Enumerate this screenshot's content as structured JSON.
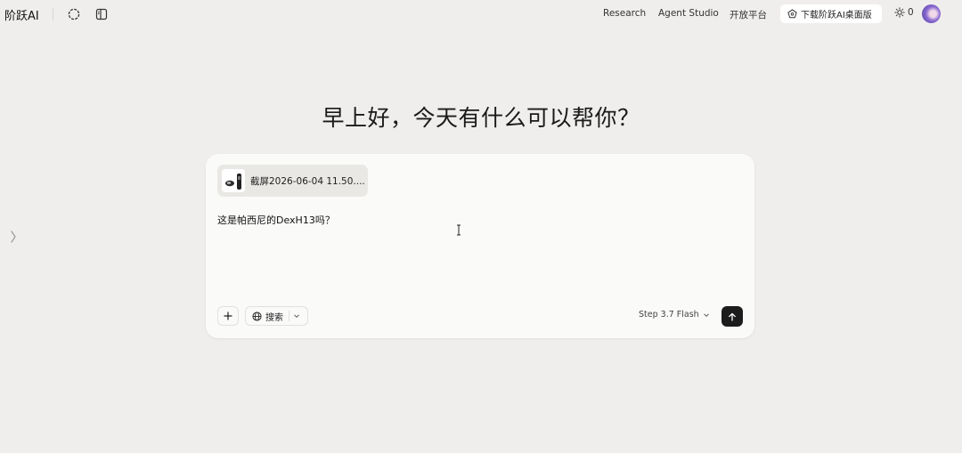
{
  "header": {
    "brand": "阶跃AI",
    "nav": [
      "Research",
      "Agent Studio",
      "开放平台"
    ],
    "download_label": "下载阶跃AI桌面版",
    "points": "0"
  },
  "main": {
    "greeting": "早上好，今天有什么可以帮你？"
  },
  "composer": {
    "attachment_name": "截屏2026-06-04 11.50....",
    "prompt": "这是帕西尼的DexH13吗？",
    "search_label": "搜索",
    "model_label": "Step 3.7 Flash"
  },
  "colors": {
    "background": "#efeeec",
    "composer_bg": "#fafaf9",
    "send_button": "#1c1c1c"
  },
  "icons": {
    "history": "circle-dashed-icon",
    "sidebar": "sidebar-panel-icon",
    "download": "pentagon-icon",
    "points": "sun-icon",
    "expand": "chevron-right-icon",
    "add": "plus-icon",
    "search": "globe-icon",
    "dropdown": "chevron-down-icon",
    "send": "arrow-up-icon",
    "cursor": "text-cursor-icon"
  }
}
